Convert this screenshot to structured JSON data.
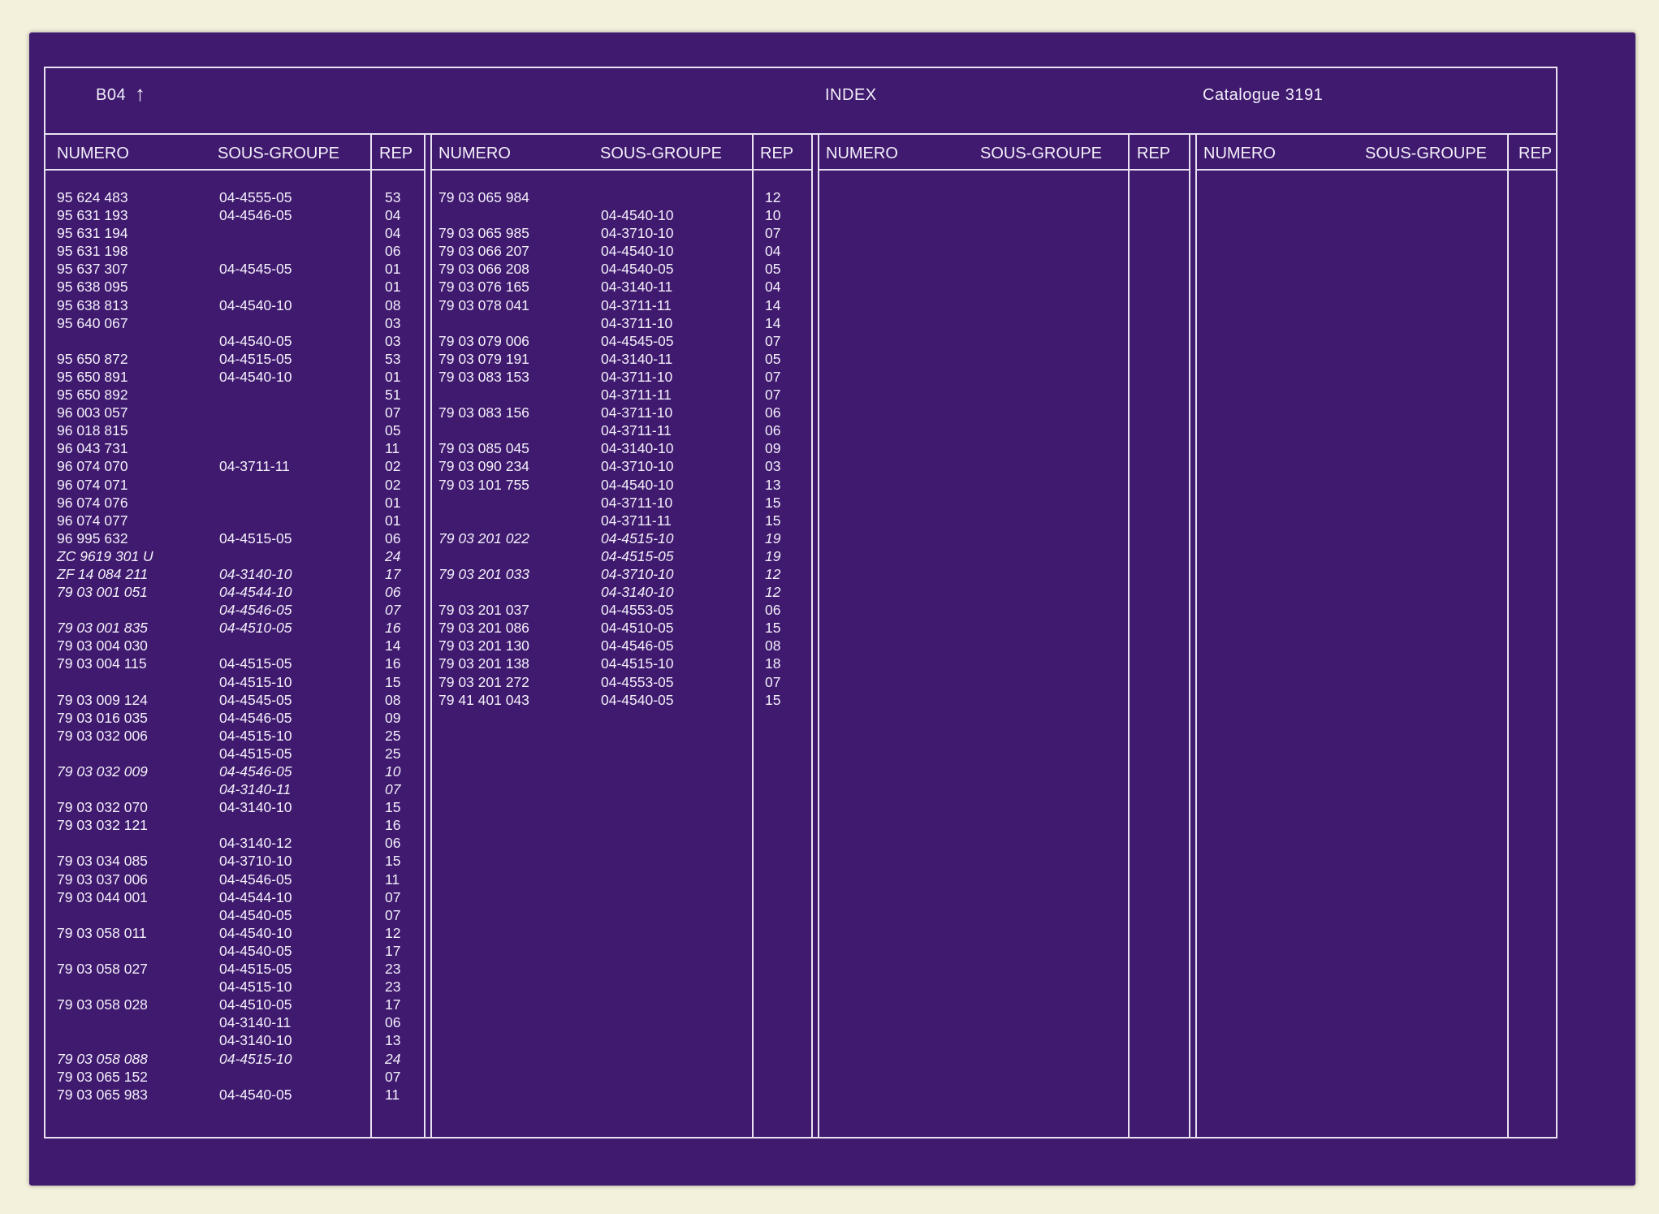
{
  "header": {
    "code": "B04",
    "title": "INDEX",
    "catalogue": "Catalogue 3191"
  },
  "columns": {
    "numero": "NUMERO",
    "sous_groupe": "SOUS-GROUPE",
    "rep": "REP"
  },
  "panel1": [
    {
      "n": "95 624 483",
      "s": "04-4555-05",
      "r": "53"
    },
    {
      "n": "95 631 193",
      "s": "04-4546-05",
      "r": "04"
    },
    {
      "n": "95 631 194",
      "s": "",
      "r": "04"
    },
    {
      "n": "95 631 198",
      "s": "",
      "r": "06"
    },
    {
      "n": "95 637 307",
      "s": "04-4545-05",
      "r": "01"
    },
    {
      "n": "95 638 095",
      "s": "",
      "r": "01"
    },
    {
      "n": "95 638 813",
      "s": "04-4540-10",
      "r": "08"
    },
    {
      "n": "95 640 067",
      "s": "",
      "r": "03"
    },
    {
      "n": "",
      "s": "04-4540-05",
      "r": "03"
    },
    {
      "n": "95 650 872",
      "s": "04-4515-05",
      "r": "53"
    },
    {
      "n": "95 650 891",
      "s": "04-4540-10",
      "r": "01"
    },
    {
      "n": "95 650 892",
      "s": "",
      "r": "51"
    },
    {
      "n": "96 003 057",
      "s": "",
      "r": "07"
    },
    {
      "n": "96 018 815",
      "s": "",
      "r": "05"
    },
    {
      "n": "96 043 731",
      "s": "",
      "r": "11"
    },
    {
      "n": "96 074 070",
      "s": "04-3711-11",
      "r": "02"
    },
    {
      "n": "96 074 071",
      "s": "",
      "r": "02"
    },
    {
      "n": "96 074 076",
      "s": "",
      "r": "01"
    },
    {
      "n": "96 074 077",
      "s": "",
      "r": "01"
    },
    {
      "n": "96 995 632",
      "s": "04-4515-05",
      "r": "06"
    },
    {
      "n": "ZC 9619 301 U",
      "s": "",
      "r": "24",
      "i": true
    },
    {
      "n": "ZF 14 084 211",
      "s": "04-3140-10",
      "r": "17",
      "i": true
    },
    {
      "n": "79 03 001 051",
      "s": "04-4544-10",
      "r": "06",
      "i": true
    },
    {
      "n": "",
      "s": "04-4546-05",
      "r": "07",
      "i": true
    },
    {
      "n": "79 03 001 835",
      "s": "04-4510-05",
      "r": "16",
      "i": true
    },
    {
      "n": "79 03 004 030",
      "s": "",
      "r": "14"
    },
    {
      "n": "79 03 004 115",
      "s": "04-4515-05",
      "r": "16"
    },
    {
      "n": "",
      "s": "04-4515-10",
      "r": "15"
    },
    {
      "n": "79 03 009 124",
      "s": "04-4545-05",
      "r": "08"
    },
    {
      "n": "79 03 016 035",
      "s": "04-4546-05",
      "r": "09"
    },
    {
      "n": "79 03 032 006",
      "s": "04-4515-10",
      "r": "25"
    },
    {
      "n": "",
      "s": "04-4515-05",
      "r": "25"
    },
    {
      "n": "79 03 032 009",
      "s": "04-4546-05",
      "r": "10",
      "i": true
    },
    {
      "n": "",
      "s": "04-3140-11",
      "r": "07",
      "i": true
    },
    {
      "n": "79 03 032 070",
      "s": "04-3140-10",
      "r": "15"
    },
    {
      "n": "79 03 032 121",
      "s": "",
      "r": "16"
    },
    {
      "n": "",
      "s": "04-3140-12",
      "r": "06"
    },
    {
      "n": "79 03 034 085",
      "s": "04-3710-10",
      "r": "15"
    },
    {
      "n": "79 03 037 006",
      "s": "04-4546-05",
      "r": "11"
    },
    {
      "n": "79 03 044 001",
      "s": "04-4544-10",
      "r": "07"
    },
    {
      "n": "",
      "s": "04-4540-05",
      "r": "07"
    },
    {
      "n": "79 03 058 011",
      "s": "04-4540-10",
      "r": "12"
    },
    {
      "n": "",
      "s": "04-4540-05",
      "r": "17"
    },
    {
      "n": "79 03 058 027",
      "s": "04-4515-05",
      "r": "23"
    },
    {
      "n": "",
      "s": "04-4515-10",
      "r": "23"
    },
    {
      "n": "79 03 058 028",
      "s": "04-4510-05",
      "r": "17"
    },
    {
      "n": "",
      "s": "04-3140-11",
      "r": "06"
    },
    {
      "n": "",
      "s": "04-3140-10",
      "r": "13"
    },
    {
      "n": "79 03 058 088",
      "s": "04-4515-10",
      "r": "24",
      "i": true
    },
    {
      "n": "79 03 065 152",
      "s": "",
      "r": "07"
    },
    {
      "n": "79 03 065 983",
      "s": "04-4540-05",
      "r": "11"
    }
  ],
  "panel2": [
    {
      "n": "79 03 065 984",
      "s": "",
      "r": "12"
    },
    {
      "n": "",
      "s": "04-4540-10",
      "r": "10"
    },
    {
      "n": "79 03 065 985",
      "s": "04-3710-10",
      "r": "07"
    },
    {
      "n": "79 03 066 207",
      "s": "04-4540-10",
      "r": "04"
    },
    {
      "n": "79 03 066 208",
      "s": "04-4540-05",
      "r": "05"
    },
    {
      "n": "79 03 076 165",
      "s": "04-3140-11",
      "r": "04"
    },
    {
      "n": "79 03 078 041",
      "s": "04-3711-11",
      "r": "14"
    },
    {
      "n": "",
      "s": "04-3711-10",
      "r": "14"
    },
    {
      "n": "79 03 079 006",
      "s": "04-4545-05",
      "r": "07"
    },
    {
      "n": "79 03 079 191",
      "s": "04-3140-11",
      "r": "05"
    },
    {
      "n": "79 03 083 153",
      "s": "04-3711-10",
      "r": "07"
    },
    {
      "n": "",
      "s": "04-3711-11",
      "r": "07"
    },
    {
      "n": "79 03 083 156",
      "s": "04-3711-10",
      "r": "06"
    },
    {
      "n": "",
      "s": "04-3711-11",
      "r": "06"
    },
    {
      "n": "79 03 085 045",
      "s": "04-3140-10",
      "r": "09"
    },
    {
      "n": "79 03 090 234",
      "s": "04-3710-10",
      "r": "03"
    },
    {
      "n": "79 03 101 755",
      "s": "04-4540-10",
      "r": "13"
    },
    {
      "n": "",
      "s": "04-3711-10",
      "r": "15"
    },
    {
      "n": "",
      "s": "04-3711-11",
      "r": "15"
    },
    {
      "n": "79 03 201 022",
      "s": "04-4515-10",
      "r": "19",
      "i": true
    },
    {
      "n": "",
      "s": "04-4515-05",
      "r": "19",
      "i": true
    },
    {
      "n": "79 03 201 033",
      "s": "04-3710-10",
      "r": "12",
      "i": true
    },
    {
      "n": "",
      "s": "04-3140-10",
      "r": "12",
      "i": true
    },
    {
      "n": "79 03 201 037",
      "s": "04-4553-05",
      "r": "06"
    },
    {
      "n": "79 03 201 086",
      "s": "04-4510-05",
      "r": "15"
    },
    {
      "n": "79 03 201 130",
      "s": "04-4546-05",
      "r": "08"
    },
    {
      "n": "79 03 201 138",
      "s": "04-4515-10",
      "r": "18"
    },
    {
      "n": "79 03 201 272",
      "s": "04-4553-05",
      "r": "07"
    },
    {
      "n": "79 41 401 043",
      "s": "04-4540-05",
      "r": "15"
    }
  ]
}
